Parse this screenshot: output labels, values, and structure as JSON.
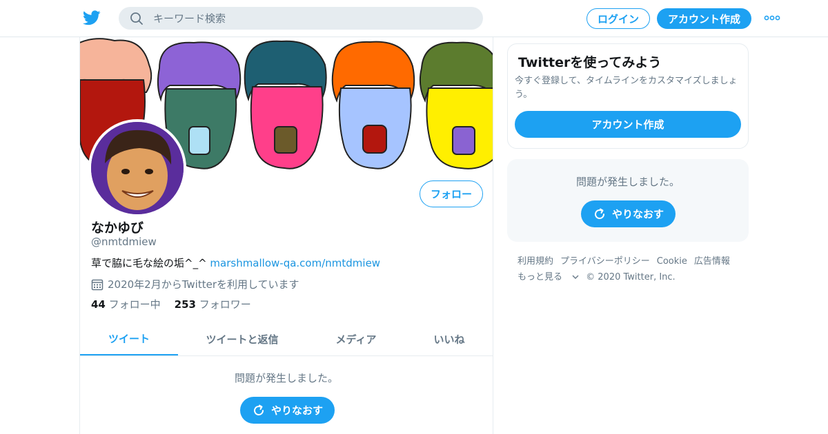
{
  "colors": {
    "accent": "#1da1f2",
    "link": "#1b95e0",
    "muted": "#657786",
    "text": "#14171a"
  },
  "header": {
    "logo_icon": "twitter-bird-icon",
    "search_placeholder": "キーワード検索",
    "login_label": "ログイン",
    "signup_label": "アカウント作成",
    "more_icon": "more-dots-icon"
  },
  "profile": {
    "name": "なかゆび",
    "handle": "@nmtdmiew",
    "bio_text": "草で脇に毛な絵の垢^_^ ",
    "bio_link": "marshmallow-qa.com/nmtdmiew",
    "joined": "2020年2月からTwitterを利用しています",
    "following_count": "44",
    "following_label": "フォロー中",
    "followers_count": "253",
    "followers_label": "フォロワー",
    "follow_label": "フォロー"
  },
  "tabs": [
    {
      "label": "ツイート",
      "active": true
    },
    {
      "label": "ツイートと返信",
      "active": false
    },
    {
      "label": "メディア",
      "active": false
    },
    {
      "label": "いいね",
      "active": false
    }
  ],
  "timeline": {
    "error_text": "問題が発生しました。",
    "retry_label": "やりなおす"
  },
  "sidebar": {
    "card_title": "Twitterを使ってみよう",
    "card_text": "今すぐ登録して、タイムラインをカスタマイズしましょう。",
    "card_signup_label": "アカウント作成",
    "error_text": "問題が発生しました。",
    "retry_label": "やりなおす"
  },
  "footer": {
    "terms": "利用規約",
    "privacy": "プライバシーポリシー",
    "cookie": "Cookie",
    "ads": "広告情報",
    "more": "もっと見る",
    "copyright": "© 2020 Twitter, Inc."
  }
}
